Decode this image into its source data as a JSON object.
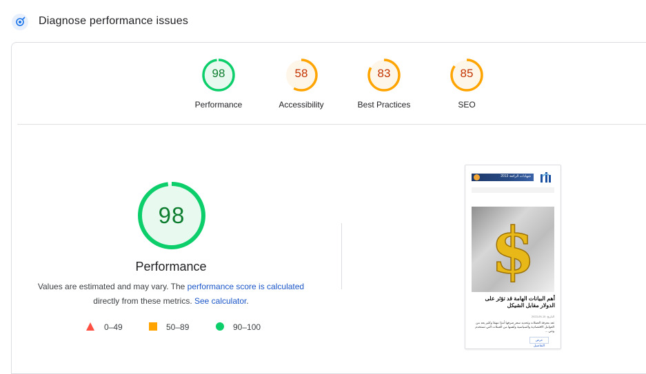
{
  "header": {
    "title": "Diagnose performance issues",
    "icon": "lighthouse-icon"
  },
  "colors": {
    "pass": "#0cce6b",
    "pass_text": "#0d7d2f",
    "average": "#ffa400",
    "average_text": "#c33300",
    "fail": "#ff4e42",
    "link": "#1a55c8"
  },
  "gauges": [
    {
      "score": "98",
      "label": "Performance",
      "status": "pass"
    },
    {
      "score": "58",
      "label": "Accessibility",
      "status": "average"
    },
    {
      "score": "83",
      "label": "Best Practices",
      "status": "average"
    },
    {
      "score": "85",
      "label": "SEO",
      "status": "average"
    }
  ],
  "performance": {
    "score": "98",
    "title": "Performance",
    "desc_prefix": "Values are estimated and may vary. The ",
    "desc_link1": "performance score is calculated",
    "desc_middle": " directly from these metrics. ",
    "desc_link2": "See calculator",
    "desc_suffix": "."
  },
  "legend": [
    {
      "range": "0–49",
      "shape": "triangle-icon"
    },
    {
      "range": "50–89",
      "shape": "square-icon"
    },
    {
      "range": "90–100",
      "shape": "circle-icon"
    }
  ],
  "screenshot": {
    "banner_text": "شهادات الرائعة 2013",
    "headline": "أهم البيانات الهامة قد تؤثر على الدولار مقابل الشيكل",
    "date": "التاريخ: 15-05-2023",
    "excerpt": "تعد معرفة العملات وتحديد سعر صرفها أمرًا مهمًا وكثير يعد من العوامل الاقتصادية والسياسية وأهمها من العملات التي تستخدم ونتي ...",
    "more_label": "عرض التفاصيل"
  }
}
